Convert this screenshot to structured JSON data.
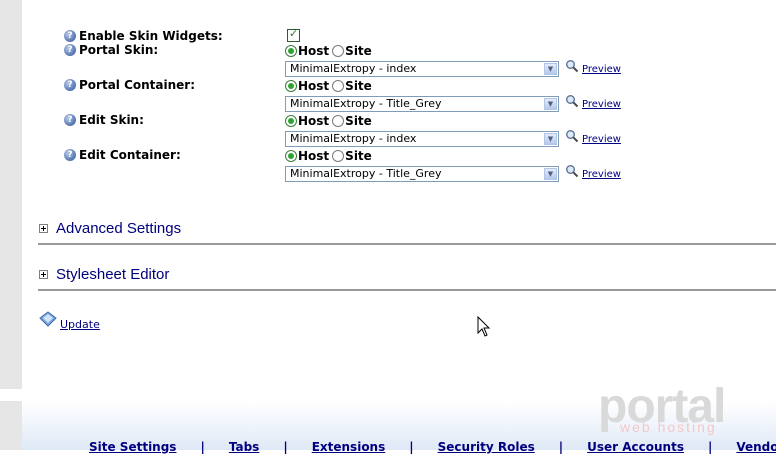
{
  "form": {
    "enable_skin_widgets": {
      "label": "Enable Skin Widgets:",
      "checked": true
    },
    "rows": [
      {
        "label": "Portal Skin:",
        "host_label": "Host",
        "site_label": "Site",
        "selected": "host",
        "value": "MinimalExtropy - index",
        "preview": "Preview"
      },
      {
        "label": "Portal Container:",
        "host_label": "Host",
        "site_label": "Site",
        "selected": "host",
        "value": "MinimalExtropy - Title_Grey",
        "preview": "Preview"
      },
      {
        "label": "Edit Skin:",
        "host_label": "Host",
        "site_label": "Site",
        "selected": "host",
        "value": "MinimalExtropy - index",
        "preview": "Preview"
      },
      {
        "label": "Edit Container:",
        "host_label": "Host",
        "site_label": "Site",
        "selected": "host",
        "value": "MinimalExtropy - Title_Grey",
        "preview": "Preview"
      }
    ],
    "help_glyph": "?"
  },
  "sections": {
    "advanced": "Advanced Settings",
    "stylesheet": "Stylesheet Editor"
  },
  "actions": {
    "update": "Update"
  },
  "logo": {
    "main": "portal",
    "sub": "web hosting"
  },
  "footer": {
    "links": [
      "Site Settings",
      "Tabs",
      "Extensions",
      "Security Roles",
      "User Accounts",
      "Vendors"
    ],
    "separator": "|"
  },
  "colors": {
    "link": "#000080",
    "section_title": "#00007f",
    "rule": "#999999",
    "radio_selected": "#2fa32f"
  }
}
